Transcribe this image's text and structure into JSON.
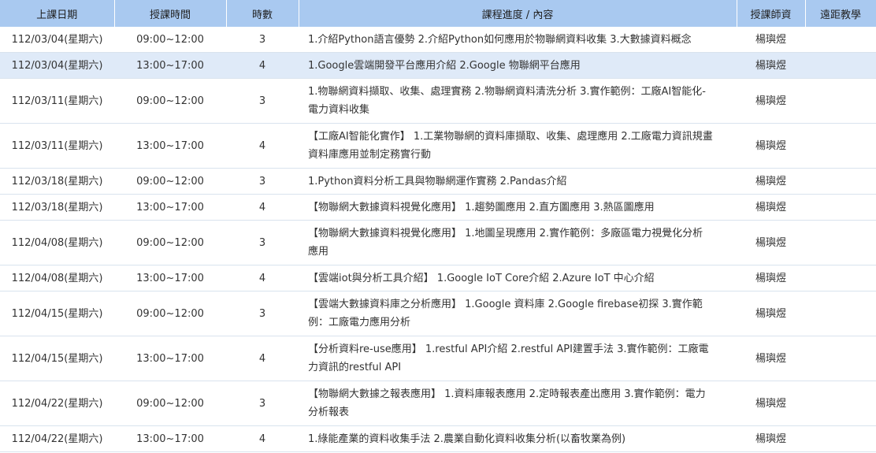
{
  "headers": {
    "date": "上課日期",
    "time": "授課時間",
    "hours": "時數",
    "content": "課程進度 / 內容",
    "teacher": "授課師資",
    "remote": "遠距教學"
  },
  "rows": [
    {
      "date": "112/03/04(星期六)",
      "time": "09:00~12:00",
      "hours": "3",
      "content": "1.介紹Python語言優勢 2.介紹Python如何應用於物聯網資料收集 3.大數據資料概念",
      "teacher": "楊璵煜",
      "remote": ""
    },
    {
      "date": "112/03/04(星期六)",
      "time": "13:00~17:00",
      "hours": "4",
      "content": "1.Google雲端開發平台應用介紹 2.Google 物聯網平台應用",
      "teacher": "楊璵煜",
      "remote": ""
    },
    {
      "date": "112/03/11(星期六)",
      "time": "09:00~12:00",
      "hours": "3",
      "content": "1.物聯網資料擷取、收集、處理實務 2.物聯網資料清洗分析 3.實作範例：工廠AI智能化-電力資料收集",
      "teacher": "楊璵煜",
      "remote": ""
    },
    {
      "date": "112/03/11(星期六)",
      "time": "13:00~17:00",
      "hours": "4",
      "content": "【工廠AI智能化實作】 1.工業物聯網的資料庫擷取、收集、處理應用 2.工廠電力資訊規畫資料庫應用並制定務實行動",
      "teacher": "楊璵煜",
      "remote": ""
    },
    {
      "date": "112/03/18(星期六)",
      "time": "09:00~12:00",
      "hours": "3",
      "content": "1.Python資料分析工具與物聯網運作實務 2.Pandas介紹",
      "teacher": "楊璵煜",
      "remote": ""
    },
    {
      "date": "112/03/18(星期六)",
      "time": "13:00~17:00",
      "hours": "4",
      "content": "【物聯網大數據資料視覺化應用】 1.趨勢圖應用 2.直方圖應用 3.熱區圖應用",
      "teacher": "楊璵煜",
      "remote": ""
    },
    {
      "date": "112/04/08(星期六)",
      "time": "09:00~12:00",
      "hours": "3",
      "content": "【物聯網大數據資料視覺化應用】 1.地圖呈現應用 2.實作範例：多廠區電力視覺化分析應用",
      "teacher": "楊璵煜",
      "remote": ""
    },
    {
      "date": "112/04/08(星期六)",
      "time": "13:00~17:00",
      "hours": "4",
      "content": "【雲端iot與分析工具介紹】 1.Google IoT Core介紹 2.Azure IoT 中心介紹",
      "teacher": "楊璵煜",
      "remote": ""
    },
    {
      "date": "112/04/15(星期六)",
      "time": "09:00~12:00",
      "hours": "3",
      "content": "【雲端大數據資料庫之分析應用】 1.Google 資料庫 2.Google firebase初探 3.實作範例：工廠電力應用分析",
      "teacher": "楊璵煜",
      "remote": ""
    },
    {
      "date": "112/04/15(星期六)",
      "time": "13:00~17:00",
      "hours": "4",
      "content": "【分析資料re-use應用】 1.restful API介紹 2.restful API建置手法 3.實作範例：工廠電力資訊的restful API",
      "teacher": "楊璵煜",
      "remote": ""
    },
    {
      "date": "112/04/22(星期六)",
      "time": "09:00~12:00",
      "hours": "3",
      "content": "【物聯網大數據之報表應用】 1.資料庫報表應用 2.定時報表產出應用 3.實作範例：電力分析報表",
      "teacher": "楊璵煜",
      "remote": ""
    },
    {
      "date": "112/04/22(星期六)",
      "time": "13:00~17:00",
      "hours": "4",
      "content": "1.綠能產業的資料收集手法 2.農業自動化資料收集分析(以畜牧業為例)",
      "teacher": "楊璵煜",
      "remote": ""
    }
  ]
}
